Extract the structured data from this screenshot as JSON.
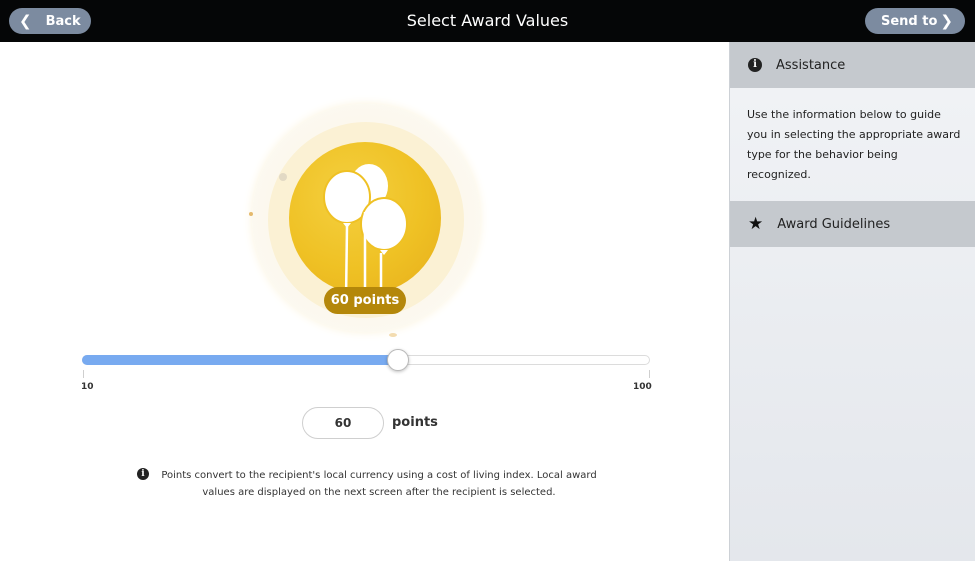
{
  "header": {
    "back_label": "Back",
    "title": "Select Award Values",
    "send_label": "Send to"
  },
  "award": {
    "badge_label": "60 points",
    "icon": "balloons-icon",
    "badge_color": "#efc124"
  },
  "slider": {
    "min_label": "10",
    "max_label": "100",
    "min": 10,
    "max": 100,
    "value": 60,
    "fill_color": "#78aaf0"
  },
  "points_field": {
    "value": "60",
    "unit_label": "points"
  },
  "note": {
    "icon": "info-icon",
    "text": "Points convert to the recipient's local currency using a cost of living index. Local award values are displayed on the next screen after the recipient is selected."
  },
  "sidebar": {
    "assistance_label": "Assistance",
    "assistance_icon": "info-icon",
    "assistance_text": "Use the information below to guide you in selecting the appropriate award type for the behavior being recognized.",
    "guidelines_label": "Award Guidelines",
    "guidelines_icon": "star-icon"
  }
}
